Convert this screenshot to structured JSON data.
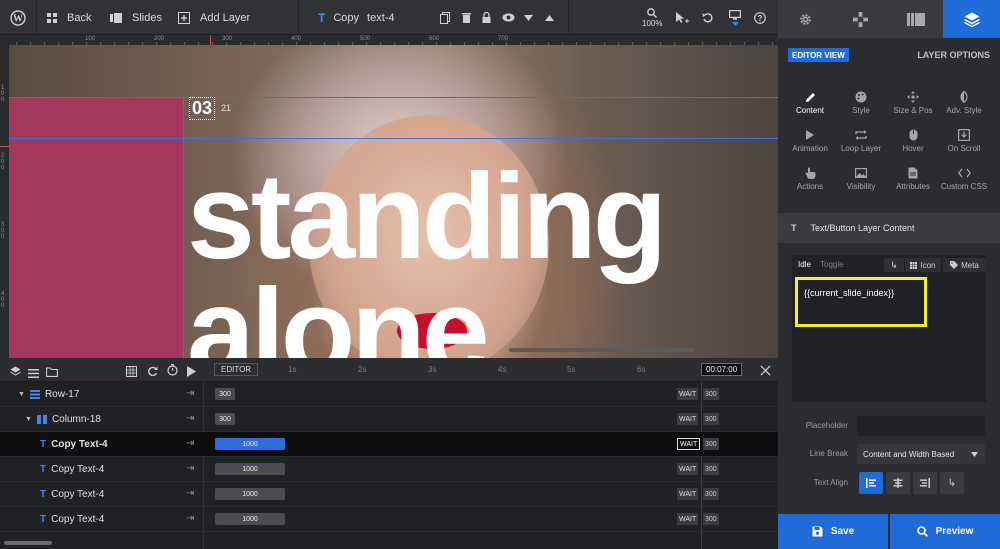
{
  "toolbar": {
    "back_label": "Back",
    "slides_label": "Slides",
    "add_layer_label": "Add Layer",
    "layer_type_label": "Copy",
    "layer_name": "text-4",
    "zoom": "100%"
  },
  "ruler": {
    "h_ticks": [
      "100",
      "200",
      "300",
      "400",
      "500",
      "600",
      "700"
    ],
    "v_ticks": [
      "1\n0\n0",
      "2\n0\n0",
      "3\n0\n0",
      "4\n0\n0",
      "5\n0\n0"
    ]
  },
  "canvas": {
    "headline_line1": "standing",
    "headline_line2": "alone",
    "layer_marker": "03",
    "layer_marker_num": "21"
  },
  "timeline": {
    "editor_label": "EDITOR",
    "duration": "00:07:00",
    "time_marks": [
      "1s",
      "2s",
      "3s",
      "4s",
      "5s",
      "6s"
    ],
    "rows": [
      {
        "name": "Row-17",
        "bar": "300",
        "wait": "WAIT",
        "end": "300"
      },
      {
        "name": "Column-18",
        "bar": "300",
        "wait": "WAIT",
        "end": "300"
      },
      {
        "name": "Copy Text-4",
        "bar": "1000",
        "wait": "WAIT",
        "end": "300"
      },
      {
        "name": "Copy Text-4",
        "bar": "1000",
        "wait": "WAIT",
        "end": "300"
      },
      {
        "name": "Copy Text-4",
        "bar": "1000",
        "wait": "WAIT",
        "end": "300"
      },
      {
        "name": "Copy Text-4",
        "bar": "1000",
        "wait": "WAIT",
        "end": "300"
      }
    ]
  },
  "panel": {
    "editor_view": "EDITOR VIEW",
    "layer_options": "LAYER OPTIONS",
    "options": [
      {
        "label": "Content",
        "icon": "pencil-icon"
      },
      {
        "label": "Style",
        "icon": "palette-icon"
      },
      {
        "label": "Size & Pos",
        "icon": "move-icon"
      },
      {
        "label": "Adv. Style",
        "icon": "contrast-icon"
      },
      {
        "label": "Animation",
        "icon": "play-icon"
      },
      {
        "label": "Loop Layer",
        "icon": "loop-icon"
      },
      {
        "label": "Hover",
        "icon": "mouse-icon"
      },
      {
        "label": "On Scroll",
        "icon": "download-icon"
      },
      {
        "label": "Actions",
        "icon": "hand-icon"
      },
      {
        "label": "Visibility",
        "icon": "image-icon"
      },
      {
        "label": "Attributes",
        "icon": "document-icon"
      },
      {
        "label": "Custom CSS",
        "icon": "code-icon"
      }
    ],
    "section_title": "Text/Button Layer Content",
    "tab_idle": "Idle",
    "tab_toggle": "Toggle",
    "icon_label": "Icon",
    "meta_label": "Meta",
    "content_value": "{{current_slide_index}}",
    "placeholder_label": "Placeholder",
    "placeholder_value": "",
    "line_break_label": "Line Break",
    "line_break_value": "Content and Width Based",
    "text_align_label": "Text Align",
    "save_label": "Save",
    "preview_label": "Preview"
  },
  "colors": {
    "accent": "#1f6bd8",
    "highlight": "#f3f21c",
    "canvas_pink": "#a8365e"
  }
}
